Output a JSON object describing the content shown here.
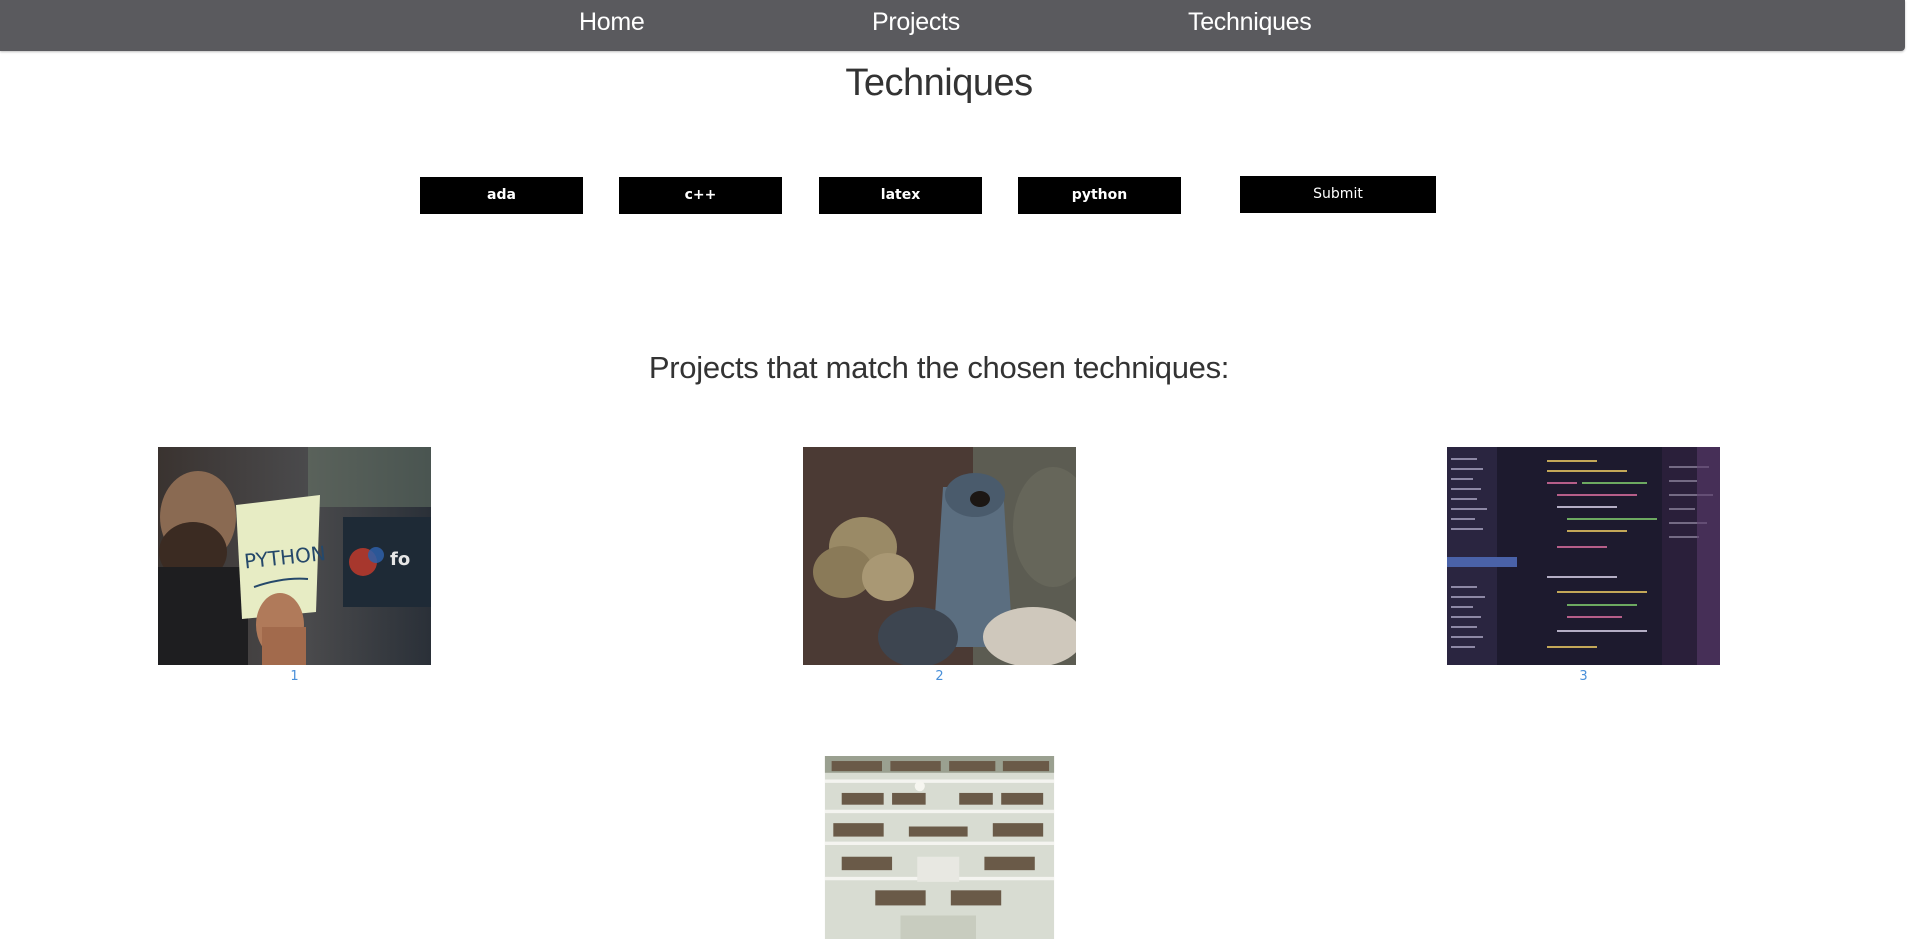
{
  "nav": {
    "items": [
      {
        "label": "Home"
      },
      {
        "label": "Projects"
      },
      {
        "label": "Techniques"
      }
    ]
  },
  "page": {
    "title": "Techniques"
  },
  "filters": {
    "techniques": [
      {
        "label": "ada"
      },
      {
        "label": "c++"
      },
      {
        "label": "latex"
      },
      {
        "label": "python"
      }
    ],
    "submit_label": "Submit"
  },
  "results": {
    "heading": "Projects that match the chosen techniques:",
    "projects": [
      {
        "label": "1",
        "image": "python-sticky-note-photo"
      },
      {
        "label": "2",
        "image": "yarn-spools-photo"
      },
      {
        "label": "3",
        "image": "code-editor-screen-photo"
      },
      {
        "label": "",
        "image": "library-atrium-photo"
      }
    ]
  },
  "colors": {
    "nav_bg": "#5a5a5e",
    "button_bg": "#000000",
    "link": "#4a90d9",
    "heading_text": "#333333"
  }
}
